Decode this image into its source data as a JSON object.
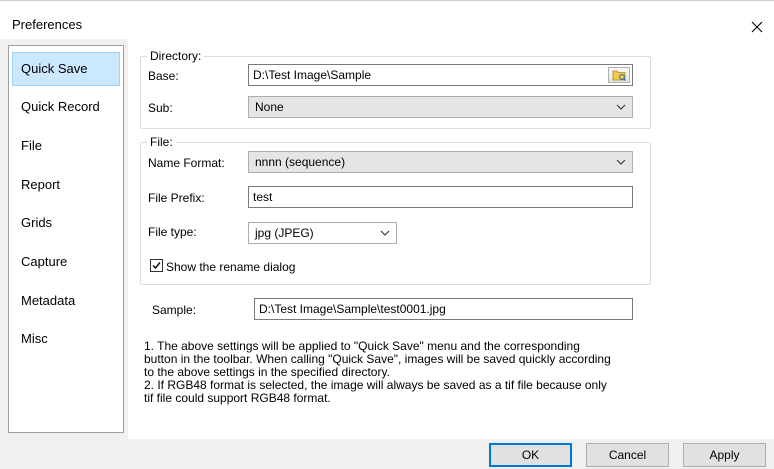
{
  "window": {
    "title": "Preferences"
  },
  "sidebar": {
    "items": [
      {
        "label": "Quick Save"
      },
      {
        "label": "Quick Record"
      },
      {
        "label": "File"
      },
      {
        "label": "Report"
      },
      {
        "label": "Grids"
      },
      {
        "label": "Capture"
      },
      {
        "label": "Metadata"
      },
      {
        "label": "Misc"
      }
    ],
    "selected": "Quick Save"
  },
  "directory": {
    "group_title": "Directory:",
    "base_label": "Base:",
    "base_value": "D:\\Test Image\\Sample",
    "sub_label": "Sub:",
    "sub_value": "None"
  },
  "file": {
    "group_title": "File:",
    "name_format_label": "Name Format:",
    "name_format_value": "nnnn (sequence)",
    "prefix_label": "File Prefix:",
    "prefix_value": "test",
    "type_label": "File type:",
    "type_value": "jpg (JPEG)",
    "rename_label": "Show the rename dialog",
    "rename_checked": true
  },
  "sample": {
    "label": "Sample:",
    "value": "D:\\Test Image\\Sample\\test0001.jpg"
  },
  "notes": {
    "line1": "1. The above settings will be applied to \"Quick Save\" menu and the corresponding",
    "line2": "button in the toolbar. When calling \"Quick Save\", images will be saved quickly according",
    "line3": "to the above settings in the specified directory.",
    "line4": "2. If RGB48 format is selected, the image will always be saved as a tif file because only",
    "line5": "tif file could support RGB48 format."
  },
  "buttons": {
    "ok": "OK",
    "cancel": "Cancel",
    "apply": "Apply"
  },
  "colors": {
    "selection": "#cce8ff",
    "default_button_border": "#0078d7"
  }
}
